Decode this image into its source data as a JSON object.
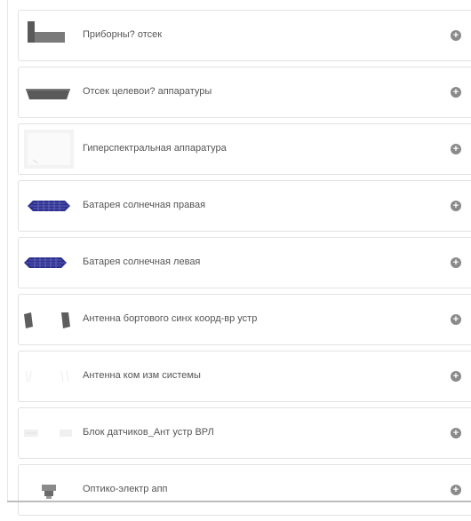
{
  "items": [
    {
      "label": "Приборны? отсек",
      "icon": "instrument-compartment-thumbnail"
    },
    {
      "label": "Отсек целевои? аппаратуры",
      "icon": "payload-compartment-thumbnail"
    },
    {
      "label": "Гиперспектральная аппаратура",
      "icon": "hyperspectral-equipment-thumbnail"
    },
    {
      "label": "Батарея солнечная правая",
      "icon": "solar-panel-right-thumbnail"
    },
    {
      "label": "Батарея солнечная левая",
      "icon": "solar-panel-left-thumbnail"
    },
    {
      "label": "Антенна бортового синх коорд-вр устр",
      "icon": "antenna-thumbnail"
    },
    {
      "label": "Антенна ком изм системы",
      "icon": "antenna-faint-thumbnail"
    },
    {
      "label": "Блок датчиков_Ант устр ВРЛ",
      "icon": "sensor-block-thumbnail"
    },
    {
      "label": "Оптико-электр апп",
      "icon": "optical-device-thumbnail"
    }
  ],
  "expand_glyph": "+",
  "colors": {
    "border": "#e2e2e2",
    "text": "#555555",
    "expand_button": "#8a8a8a",
    "solar_panel": "#2d2f8f"
  }
}
